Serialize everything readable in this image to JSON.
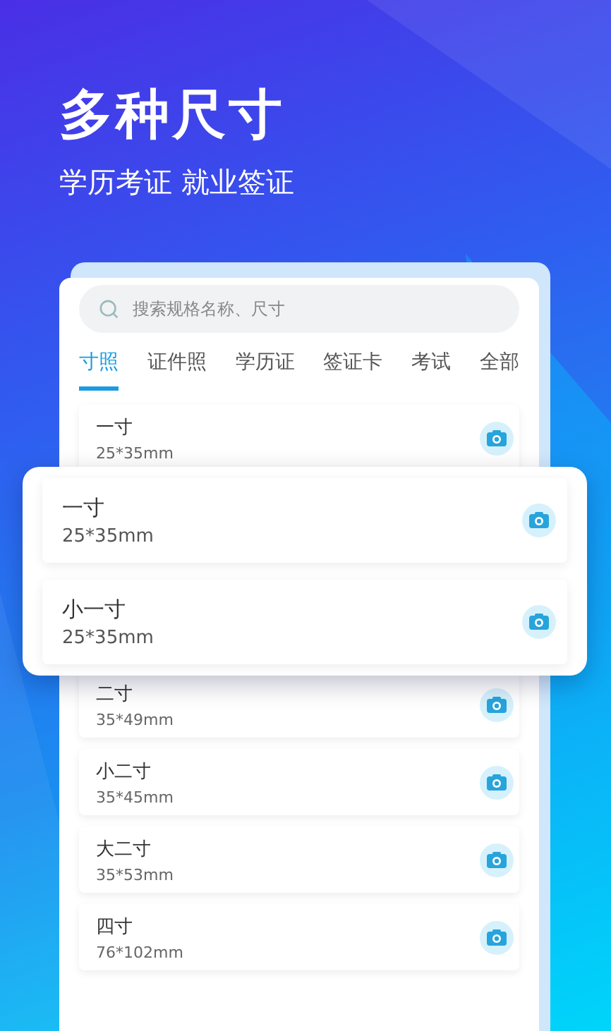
{
  "headline": "多种尺寸",
  "subheadline": "学历考证 就业签证",
  "search": {
    "placeholder": "搜索规格名称、尺寸"
  },
  "tabs": [
    {
      "label": "寸照",
      "selected": true
    },
    {
      "label": "证件照",
      "selected": false
    },
    {
      "label": "学历证",
      "selected": false
    },
    {
      "label": "签证卡",
      "selected": false
    },
    {
      "label": "考试",
      "selected": false
    },
    {
      "label": "全部",
      "selected": false
    }
  ],
  "list_top": [
    {
      "name": "一寸",
      "size": "25*35mm"
    }
  ],
  "popup": [
    {
      "name": "一寸",
      "size": "25*35mm"
    },
    {
      "name": "小一寸",
      "size": "25*35mm"
    }
  ],
  "list_bottom": [
    {
      "name": "二寸",
      "size": "35*49mm"
    },
    {
      "name": "小二寸",
      "size": "35*45mm"
    },
    {
      "name": "大二寸",
      "size": "35*53mm"
    },
    {
      "name": "四寸",
      "size": "76*102mm"
    }
  ]
}
